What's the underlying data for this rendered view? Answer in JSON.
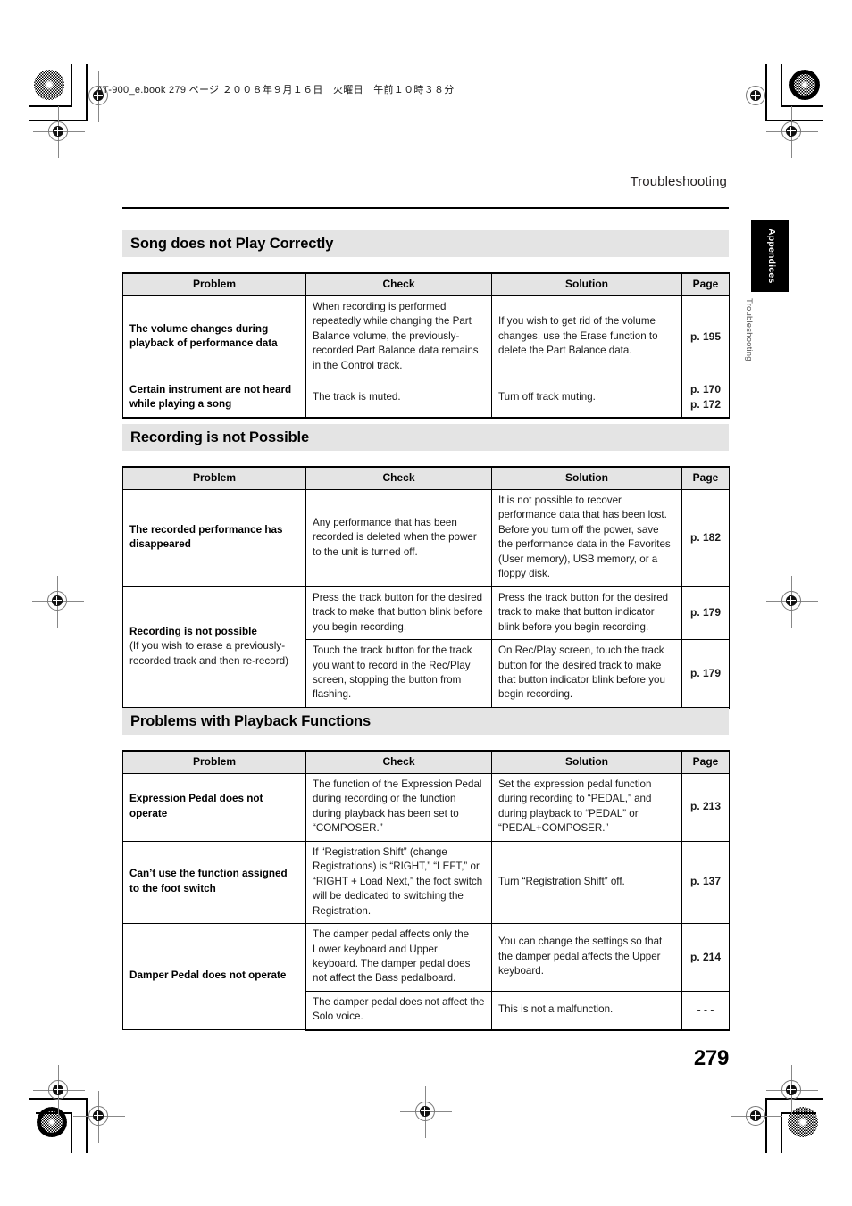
{
  "print_slug": "AT-900_e.book  279 ページ  ２００８年９月１６日　火曜日　午前１０時３８分",
  "running_head": "Troubleshooting",
  "thumb_tab": {
    "label": "Appendices",
    "sub_label": "Troubleshooting"
  },
  "folio": "279",
  "table_headers": [
    "Problem",
    "Check",
    "Solution",
    "Page"
  ],
  "sections": [
    {
      "title": "Song does not Play Correctly",
      "rows": [
        {
          "problem": "The volume changes during playback of performance data",
          "problem_sub": "",
          "check": "When recording is performed repeatedly while changing the Part Balance volume, the previously-recorded Part Balance data remains in the Control track.",
          "solution": "If you wish to get rid of the volume changes, use the Erase function to delete the Part Balance data.",
          "pages": [
            "p. 195"
          ],
          "problem_rowspan": 1
        },
        {
          "problem": "Certain instrument are not heard while playing a song",
          "problem_sub": "",
          "check": "The track is muted.",
          "solution": "Turn off track muting.",
          "pages": [
            "p. 170",
            "p. 172"
          ],
          "problem_rowspan": 1
        }
      ]
    },
    {
      "title": "Recording is not Possible",
      "rows": [
        {
          "problem": "The recorded performance has disappeared",
          "problem_sub": "",
          "check": "Any performance that has been recorded is deleted when the power to the unit is turned off.",
          "solution": "It is not possible to recover performance data that has been lost. Before you turn off the power, save the performance data in the Favorites (User memory), USB memory, or a floppy disk.",
          "pages": [
            "p. 182"
          ],
          "problem_rowspan": 1
        },
        {
          "problem": "Recording is not possible",
          "problem_sub": "(If you wish to erase a previously-recorded track and then re-record)",
          "check": "Press the track button for the desired track to make that button blink before you begin recording.",
          "solution": "Press the track button for the desired track to make that button indicator blink before you begin recording.",
          "pages": [
            "p. 179"
          ],
          "problem_rowspan": 2
        },
        {
          "problem": "",
          "problem_sub": "",
          "check": "Touch the track button for the track you want to record in the Rec/Play screen, stopping the button from flashing.",
          "solution": "On Rec/Play screen, touch the track button for the desired track to make that button indicator blink before you begin recording.",
          "pages": [
            "p. 179"
          ],
          "problem_rowspan": 0
        }
      ]
    },
    {
      "title": "Problems with Playback Functions",
      "rows": [
        {
          "problem": "Expression Pedal does not operate",
          "problem_sub": "",
          "check": "The function of the Expression Pedal during recording or the function during playback has been set to “COMPOSER.”",
          "solution": "Set the expression pedal function during recording to “PEDAL,” and during playback to “PEDAL” or “PEDAL+COMPOSER.”",
          "pages": [
            "p. 213"
          ],
          "problem_rowspan": 1
        },
        {
          "problem": "Can’t use the function assigned to the foot switch",
          "problem_sub": "",
          "check": "If “Registration Shift” (change Registrations) is “RIGHT,” “LEFT,” or “RIGHT + Load Next,” the foot switch will be dedicated to switching the Registration.",
          "solution": "Turn “Registration Shift” off.",
          "pages": [
            "p. 137"
          ],
          "problem_rowspan": 1
        },
        {
          "problem": "Damper Pedal does not operate",
          "problem_sub": "",
          "check": "The damper pedal affects only the Lower keyboard and Upper keyboard. The damper pedal does not affect the Bass pedalboard.",
          "solution": "You can change the settings so that the damper pedal affects the Upper keyboard.",
          "pages": [
            "p. 214"
          ],
          "problem_rowspan": 2
        },
        {
          "problem": "",
          "problem_sub": "",
          "check": "The damper pedal does not affect the Solo voice.",
          "solution": "This is not a malfunction.",
          "pages": [
            "- - -"
          ],
          "problem_rowspan": 0
        }
      ]
    }
  ]
}
